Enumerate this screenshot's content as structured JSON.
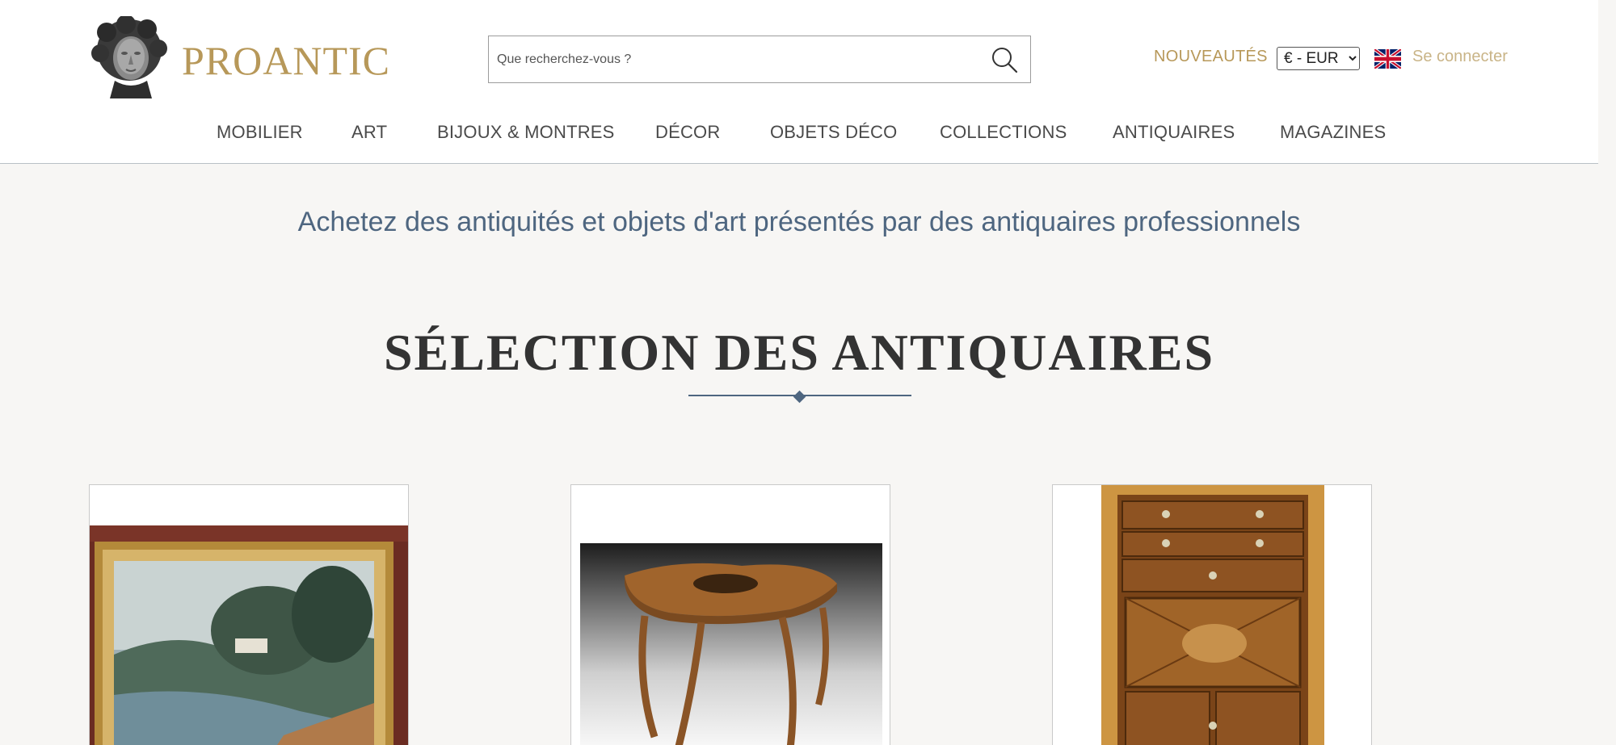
{
  "header": {
    "logo_text": "PROANTIC",
    "search_placeholder": "Que recherchez-vous ?",
    "nouveautes": "NOUVEAUTÉS",
    "currency_selected": "€ - EUR",
    "connect": "Se connecter",
    "brand_color": "#b79859"
  },
  "nav": {
    "items": [
      "MOBILIER",
      "ART",
      "BIJOUX & MONTRES",
      "DÉCOR",
      "OBJETS DÉCO",
      "COLLECTIONS",
      "ANTIQUAIRES",
      "MAGAZINES"
    ]
  },
  "main": {
    "tagline": "Achetez des antiquités et objets d'art présentés par des antiquaires professionnels",
    "section_title": "SÉLECTION DES ANTIQUAIRES",
    "accent_color": "#4e6680"
  },
  "icons": {
    "logo": "classical-bust-icon",
    "search": "magnifier-icon",
    "flag": "uk-flag-icon"
  }
}
